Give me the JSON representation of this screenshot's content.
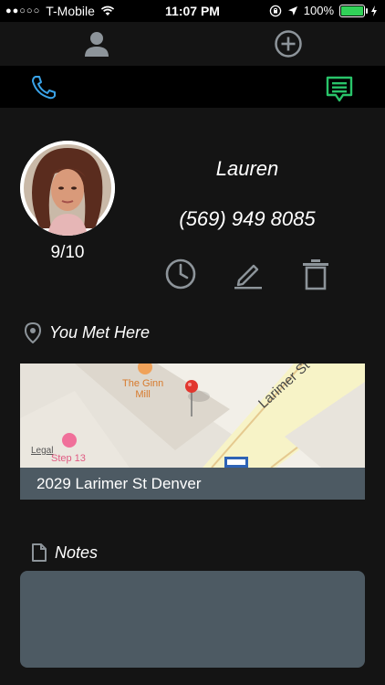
{
  "status": {
    "signal": "●●○○○",
    "carrier": "T-Mobile",
    "time": "11:07 PM",
    "battery": "100%",
    "battery_level": 1.0
  },
  "contact": {
    "name": "Lauren",
    "phone": "(569) 949 8085",
    "rating": "9/10"
  },
  "met": {
    "label": "You Met Here",
    "address": "2029 Larimer St Denver",
    "map_labels": {
      "poi1": "The Ginn",
      "poi1b": "Mill",
      "street": "Larimer St",
      "legal": "Legal",
      "poi2": "Step 13"
    }
  },
  "notes": {
    "label": "Notes",
    "value": ""
  },
  "colors": {
    "accent_blue": "#3aa3e8",
    "accent_green": "#29c46a",
    "icon_gray": "#8d949a",
    "panel": "#4d5a63"
  },
  "icons": {
    "profile": "person-icon",
    "add": "add-circle-icon",
    "call": "phone-icon",
    "message": "message-icon",
    "history": "clock-icon",
    "edit": "pencil-icon",
    "delete": "trash-icon",
    "location": "location-pin-icon",
    "notes": "document-icon"
  }
}
